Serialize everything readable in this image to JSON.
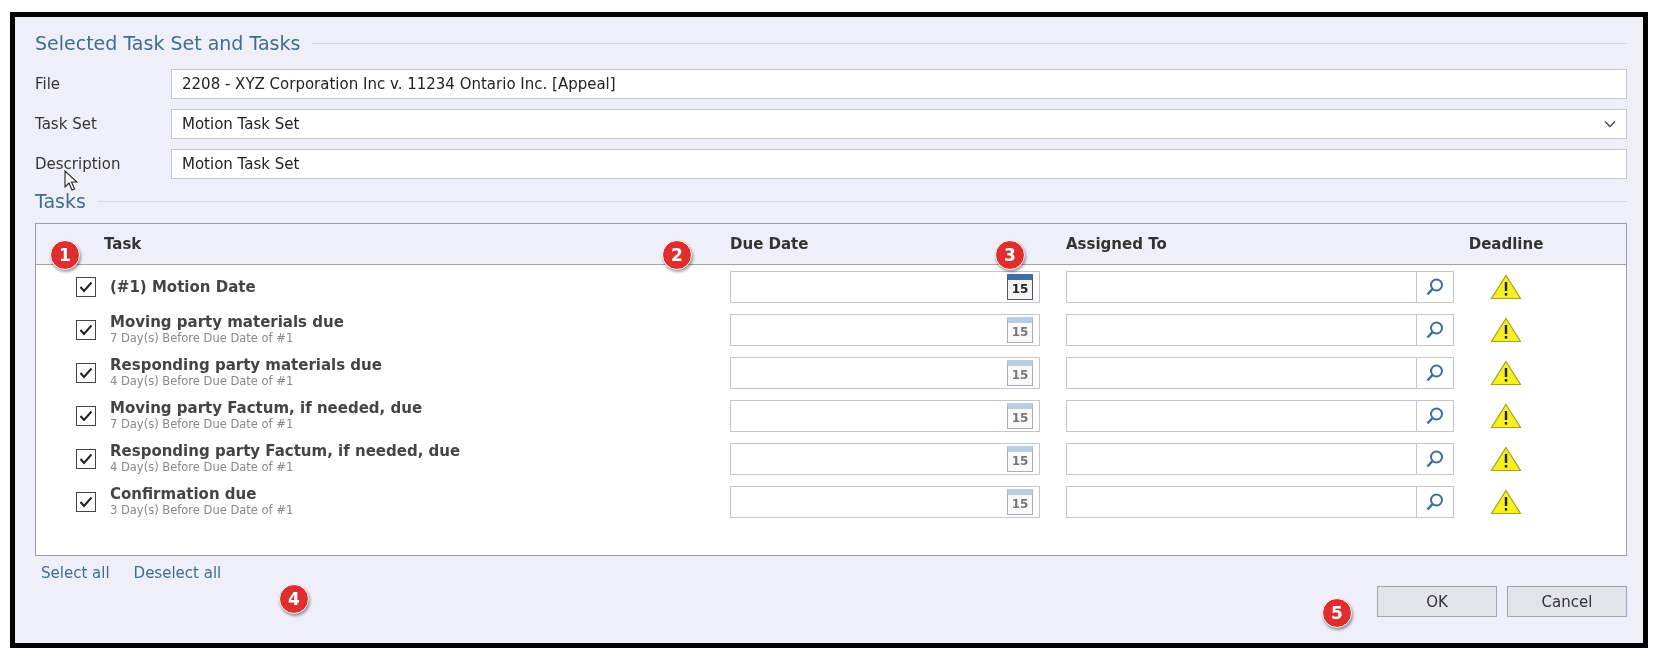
{
  "section_title": "Selected Task Set and Tasks",
  "fields": [
    {
      "kind": "text",
      "label": "File",
      "value": "2208 - XYZ Corporation Inc v. 11234 Ontario Inc. [Appeal]"
    },
    {
      "kind": "dropdown",
      "label": "Task Set",
      "value": "Motion Task Set"
    },
    {
      "kind": "text",
      "label": "Description",
      "value": "Motion Task Set"
    }
  ],
  "tasks_title": "Tasks",
  "table": {
    "columns": [
      "Task",
      "Due Date",
      "Assigned To",
      "Deadline"
    ],
    "rows": [
      {
        "checked": true,
        "task": "(#1) Motion Date",
        "calendar_enabled": true,
        "calendar_day": "15"
      },
      {
        "checked": true,
        "task": "Moving party materials due",
        "note": "7 Day(s) Before Due Date of #1",
        "calendar_enabled": false,
        "calendar_day": "15"
      },
      {
        "checked": true,
        "task": "Responding party materials due",
        "note": "4 Day(s) Before Due Date of #1",
        "calendar_enabled": false,
        "calendar_day": "15"
      },
      {
        "checked": true,
        "task": "Moving party Factum, if needed, due",
        "note": "7 Day(s) Before Due Date of #1",
        "calendar_enabled": false,
        "calendar_day": "15"
      },
      {
        "checked": true,
        "task": "Responding party Factum, if needed, due",
        "note": "4 Day(s) Before Due Date of #1",
        "calendar_enabled": false,
        "calendar_day": "15"
      },
      {
        "checked": true,
        "task": "Confirmation due",
        "note": "3 Day(s) Before Due Date of #1",
        "calendar_enabled": false,
        "calendar_day": "15"
      }
    ]
  },
  "links": [
    "Select all",
    "Deselect all"
  ],
  "buttons": [
    "OK",
    "Cancel"
  ],
  "callouts": [
    "1",
    "2",
    "3",
    "4",
    "5"
  ]
}
